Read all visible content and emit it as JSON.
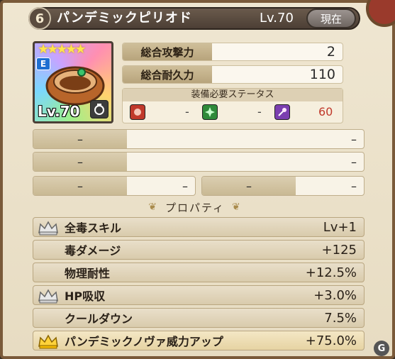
{
  "header": {
    "slot_number": "6",
    "item_name": "パンデミックピリオド",
    "level": "Lv.70",
    "equip_status": "現在"
  },
  "item_card": {
    "element": "E",
    "stars": "★★★★★",
    "level": "Lv.70",
    "icon": "ring-icon"
  },
  "stats": {
    "attack_label": "総合攻撃力",
    "attack_value": "2",
    "durability_label": "総合耐久力",
    "durability_value": "110",
    "requirement_title": "装備必要ステータス",
    "requirements": [
      {
        "icon": "fist-icon",
        "value": "-",
        "color": "#c0392b"
      },
      {
        "icon": "sparkle-icon",
        "value": "-",
        "color": "#2f8a3a"
      },
      {
        "icon": "magic-wand-icon",
        "value": "60",
        "color": "#7b3fb0"
      }
    ]
  },
  "empty_slots": {
    "dash": "–"
  },
  "properties": {
    "title": "プロパティ",
    "rows": [
      {
        "name": "全毒スキル",
        "value": "Lv+1",
        "crown": "silver"
      },
      {
        "name": "毒ダメージ",
        "value": "+125",
        "crown": ""
      },
      {
        "name": "物理耐性",
        "value": "+12.5%",
        "crown": ""
      },
      {
        "name": "HP吸収",
        "value": "+3.0%",
        "crown": "silver"
      },
      {
        "name": "クールダウン",
        "value": "7.5%",
        "crown": ""
      },
      {
        "name": "パンデミックノヴァ威力アップ",
        "value": "+75.0%",
        "crown": "gold"
      }
    ]
  },
  "watermark": "G"
}
